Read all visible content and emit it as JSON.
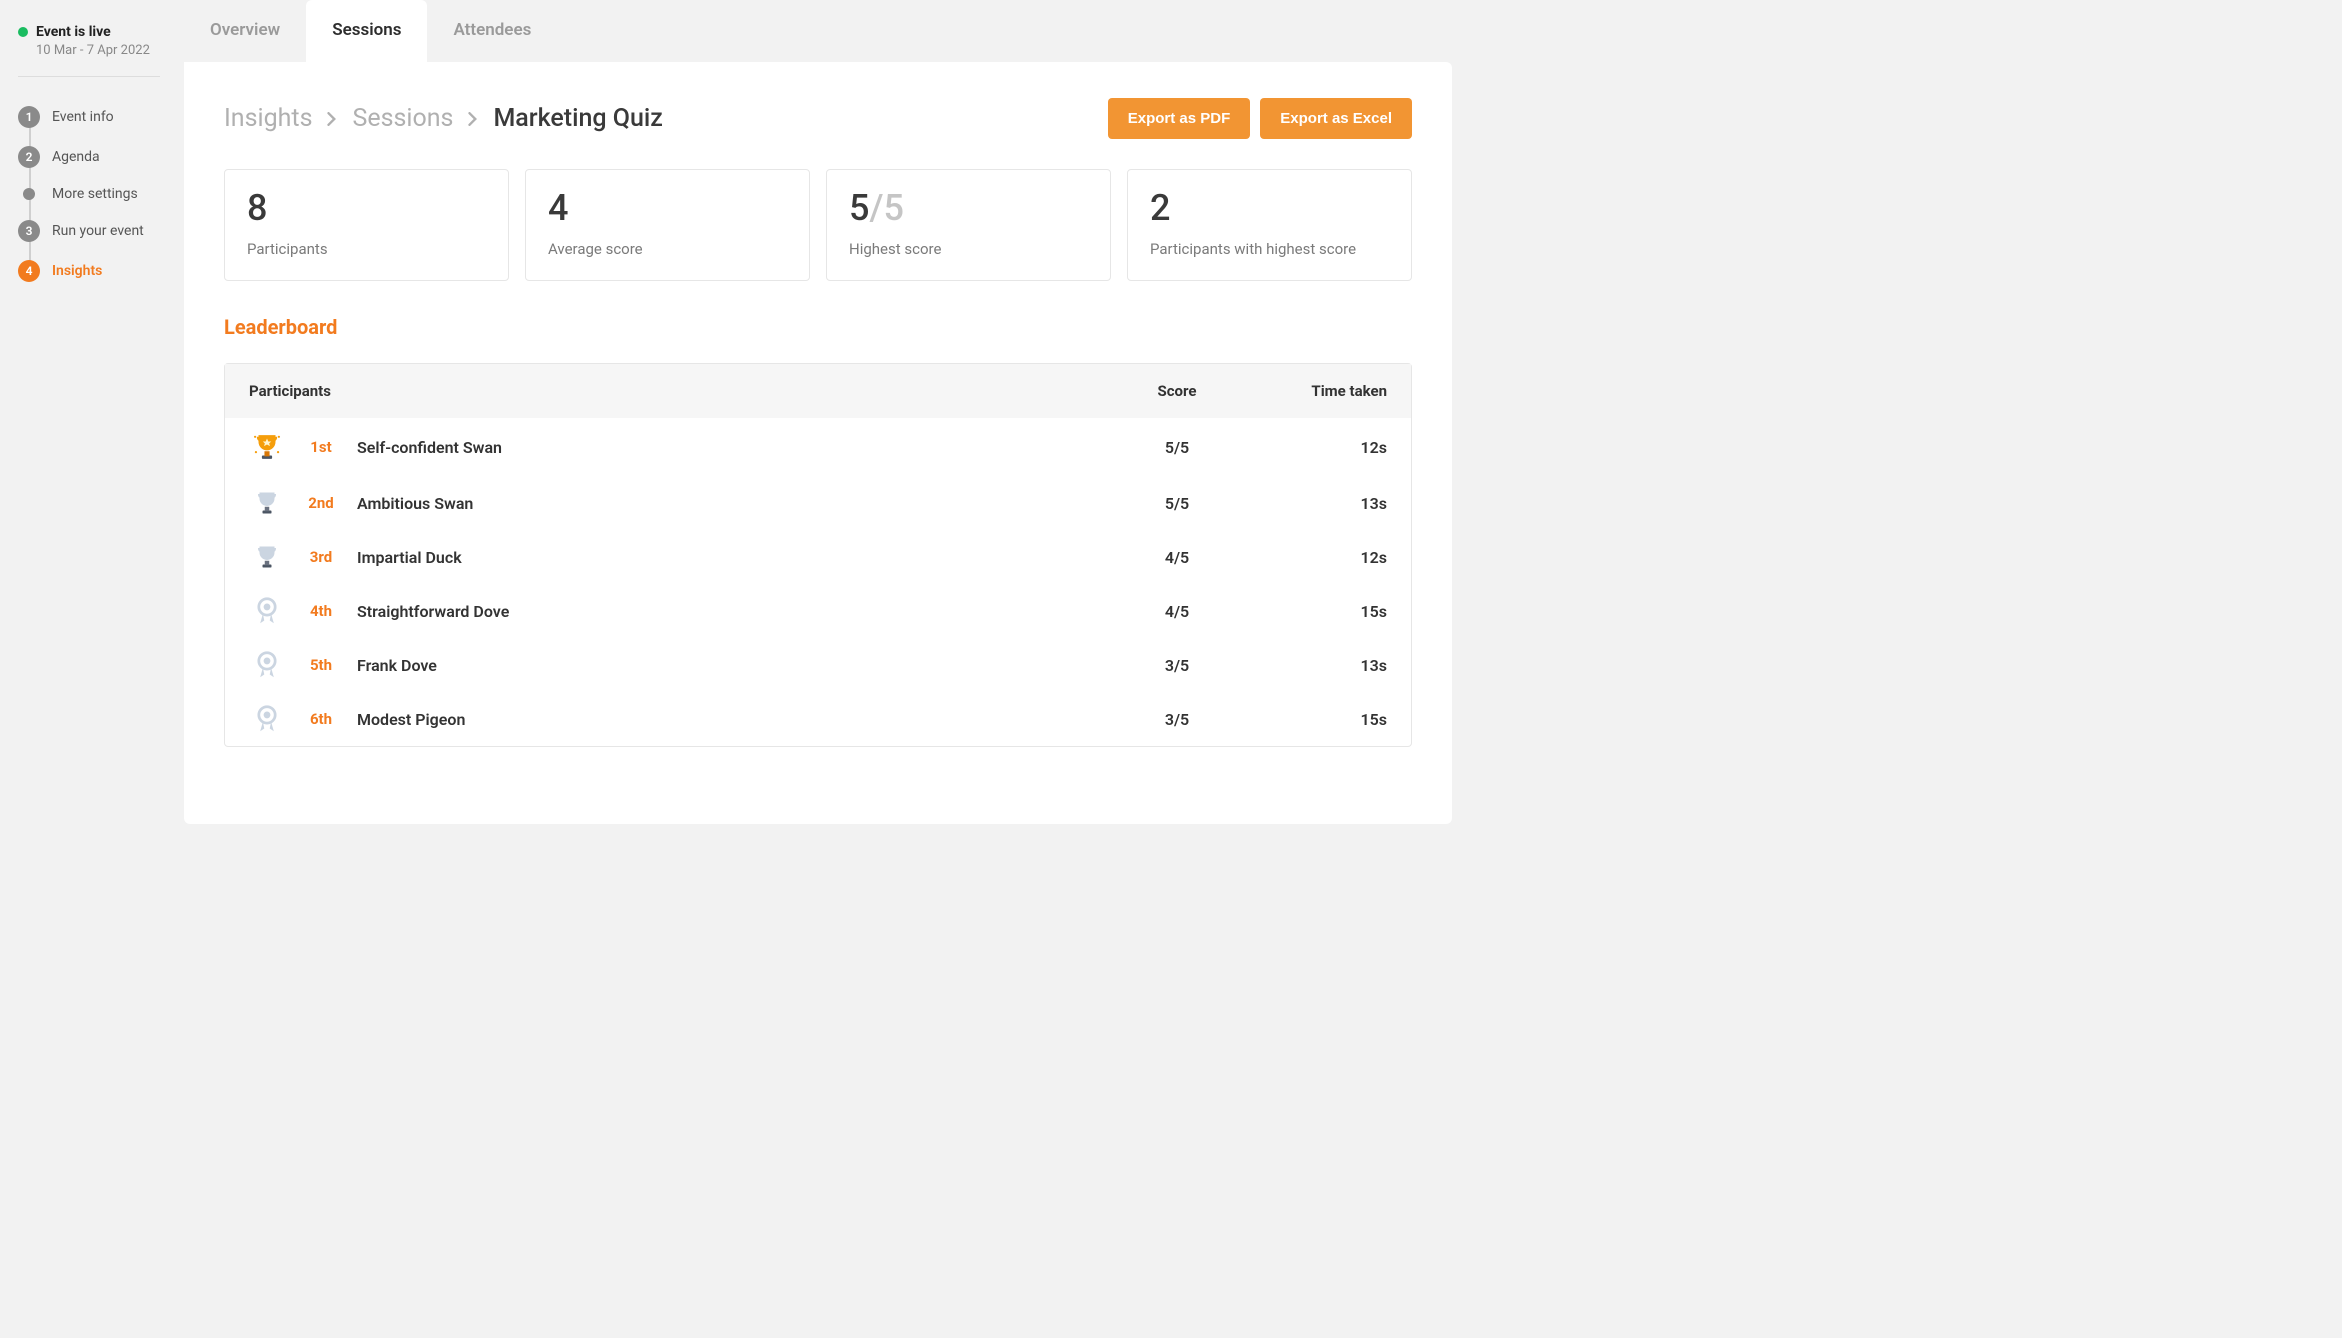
{
  "sidebar": {
    "status_label": "Event is live",
    "status_date": "10 Mar - 7 Apr 2022",
    "steps": [
      {
        "num": "1",
        "label": "Event info",
        "type": "num"
      },
      {
        "num": "2",
        "label": "Agenda",
        "type": "num"
      },
      {
        "num": "",
        "label": "More settings",
        "type": "dot"
      },
      {
        "num": "3",
        "label": "Run your event",
        "type": "num"
      },
      {
        "num": "4",
        "label": "Insights",
        "type": "num",
        "active": true
      }
    ]
  },
  "tabs": {
    "overview": "Overview",
    "sessions": "Sessions",
    "attendees": "Attendees"
  },
  "breadcrumb": {
    "a": "Insights",
    "b": "Sessions",
    "c": "Marketing Quiz"
  },
  "actions": {
    "pdf": "Export as PDF",
    "excel": "Export as Excel"
  },
  "stats": {
    "participants": {
      "value": "8",
      "label": "Participants"
    },
    "avg": {
      "value": "4",
      "label": "Average score"
    },
    "highest": {
      "value": "5",
      "max": "/5",
      "label": "Highest score"
    },
    "top_count": {
      "value": "2",
      "label": "Participants with highest score"
    }
  },
  "leaderboard": {
    "title": "Leaderboard",
    "headers": {
      "p": "Participants",
      "s": "Score",
      "t": "Time taken"
    },
    "rows": [
      {
        "rank": "1st",
        "name": "Self-confident Swan",
        "score": "5/5",
        "time": "12s",
        "trophy": "gold"
      },
      {
        "rank": "2nd",
        "name": "Ambitious Swan",
        "score": "5/5",
        "time": "13s",
        "trophy": "silver"
      },
      {
        "rank": "3rd",
        "name": "Impartial Duck",
        "score": "4/5",
        "time": "12s",
        "trophy": "silver"
      },
      {
        "rank": "4th",
        "name": "Straightforward Dove",
        "score": "4/5",
        "time": "15s",
        "trophy": "medal"
      },
      {
        "rank": "5th",
        "name": "Frank Dove",
        "score": "3/5",
        "time": "13s",
        "trophy": "medal"
      },
      {
        "rank": "6th",
        "name": "Modest Pigeon",
        "score": "3/5",
        "time": "15s",
        "trophy": "medal"
      }
    ]
  }
}
